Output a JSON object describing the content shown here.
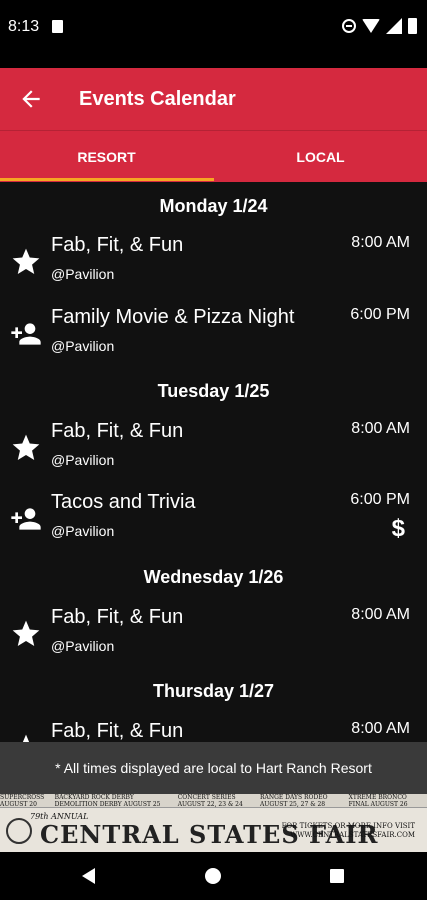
{
  "status_bar": {
    "time": "8:13"
  },
  "app_bar": {
    "title": "Events Calendar"
  },
  "tabs": [
    {
      "label": "RESORT",
      "selected": true
    },
    {
      "label": "LOCAL",
      "selected": false
    }
  ],
  "colors": {
    "primary": "#d5293f",
    "tab_indicator": "#f5a623",
    "background": "#111111"
  },
  "days": [
    {
      "header": "Monday 1/24",
      "events": [
        {
          "icon": "star-icon",
          "title": "Fab, Fit, & Fun",
          "location": "@Pavilion",
          "time": "8:00 AM"
        },
        {
          "icon": "person-add-icon",
          "title": "Family Movie & Pizza  Night",
          "location": "@Pavilion",
          "time": "6:00 PM"
        }
      ]
    },
    {
      "header": "Tuesday 1/25",
      "events": [
        {
          "icon": "star-icon",
          "title": "Fab, Fit, & Fun",
          "location": "@Pavilion",
          "time": "8:00 AM"
        },
        {
          "icon": "person-add-icon",
          "title": "Tacos and Trivia",
          "location": "@Pavilion",
          "time": "6:00 PM",
          "price": "$"
        }
      ]
    },
    {
      "header": "Wednesday 1/26",
      "events": [
        {
          "icon": "star-icon",
          "title": "Fab, Fit, & Fun",
          "location": "@Pavilion",
          "time": "8:00 AM"
        }
      ]
    },
    {
      "header": "Thursday 1/27",
      "events": [
        {
          "icon": "star-icon",
          "title": "Fab, Fit, & Fun",
          "time": "8:00 AM"
        }
      ]
    }
  ],
  "disclaimer": "* All times displayed are local to Hart Ranch Resort",
  "ad": {
    "top_items": [
      "SUPERCROSS AUGUST 20",
      "BACKYARD ROCK DERBY DEMOLITION DERBY AUGUST 25",
      "CONCERT SERIES AUGUST 22, 23 & 24",
      "RANGE DAYS RODEO AUGUST 25, 27 & 28",
      "XTREME BRONCO FINAL AUGUST 26"
    ],
    "annual": "79th ANNUAL",
    "title": "CENTRAL STATES FAIR",
    "info_line1": "FOR TICKETS OR MORE INFO VISIT",
    "info_line2": "WWW.CENTRALSTATESFAIR.COM"
  }
}
